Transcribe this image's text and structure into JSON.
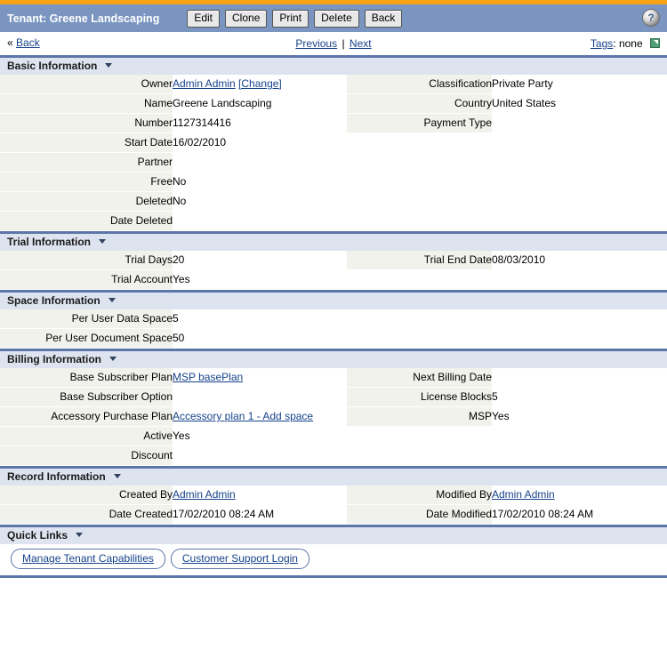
{
  "theme": {
    "accent_orange": "#f9a216",
    "title_bar_blue": "#7a95c0",
    "section_header_blue": "#dde3ef",
    "section_rule_blue": "#5b76a8",
    "label_cell_bg": "#f1f2ec",
    "link_blue": "#15428b"
  },
  "header": {
    "title": "Tenant: Greene Landscaping",
    "buttons": [
      {
        "label": "Edit"
      },
      {
        "label": "Clone"
      },
      {
        "label": "Print"
      },
      {
        "label": "Delete"
      },
      {
        "label": "Back"
      }
    ],
    "help_icon": "?",
    "help_icon_name": "help-icon"
  },
  "nav": {
    "back_chevron": "«",
    "back_label": "Back",
    "previous_label": "Previous",
    "separator": "|",
    "next_label": "Next",
    "tags_label": "Tags",
    "tags_colon": ":",
    "tags_value": "none"
  },
  "sections": [
    {
      "id": "basic-information",
      "title": "Basic Information",
      "rows": [
        {
          "left": {
            "label": "Owner",
            "value": "Admin Admin",
            "link": true,
            "extra": "[Change]",
            "extra_link": true
          },
          "right": {
            "label": "Classification",
            "value": "Private Party"
          }
        },
        {
          "left": {
            "label": "Name",
            "value": "Greene Landscaping"
          },
          "right": {
            "label": "Country",
            "value": "United States"
          }
        },
        {
          "left": {
            "label": "Number",
            "value": "1127314416"
          },
          "right": {
            "label": "Payment Type",
            "value": ""
          }
        },
        {
          "left": {
            "label": "Start Date",
            "value": "16/02/2010"
          },
          "right": null
        },
        {
          "left": {
            "label": "Partner",
            "value": ""
          },
          "right": null
        },
        {
          "left": {
            "label": "Free",
            "value": "No"
          },
          "right": null
        },
        {
          "left": {
            "label": "Deleted",
            "value": "No"
          },
          "right": null
        },
        {
          "left": {
            "label": "Date Deleted",
            "value": ""
          },
          "right": null
        }
      ]
    },
    {
      "id": "trial-information",
      "title": "Trial Information",
      "rows": [
        {
          "left": {
            "label": "Trial Days",
            "value": "20"
          },
          "right": {
            "label": "Trial End Date",
            "value": "08/03/2010"
          }
        },
        {
          "left": {
            "label": "Trial Account",
            "value": "Yes"
          },
          "right": null
        }
      ]
    },
    {
      "id": "space-information",
      "title": "Space Information",
      "rows": [
        {
          "left": {
            "label": "Per User Data Space",
            "value": "5"
          },
          "right": null
        },
        {
          "left": {
            "label": "Per User Document Space",
            "value": "50"
          },
          "right": null
        }
      ]
    },
    {
      "id": "billing-information",
      "title": "Billing Information",
      "rows": [
        {
          "left": {
            "label": "Base Subscriber Plan",
            "value": "MSP basePlan",
            "link": true
          },
          "right": {
            "label": "Next Billing Date",
            "value": ""
          }
        },
        {
          "left": {
            "label": "Base Subscriber Option",
            "value": ""
          },
          "right": {
            "label": "License Blocks",
            "value": "5"
          }
        },
        {
          "left": {
            "label": "Accessory Purchase Plan",
            "value": "Accessory plan 1 - Add space",
            "link": true
          },
          "right": {
            "label": "MSP",
            "value": "Yes"
          }
        },
        {
          "left": {
            "label": "Active",
            "value": "Yes"
          },
          "right": null
        },
        {
          "left": {
            "label": "Discount",
            "value": ""
          },
          "right": null
        }
      ]
    },
    {
      "id": "record-information",
      "title": "Record Information",
      "rows": [
        {
          "left": {
            "label": "Created By",
            "value": "Admin Admin",
            "link": true
          },
          "right": {
            "label": "Modified By",
            "value": "Admin Admin",
            "link": true
          }
        },
        {
          "left": {
            "label": "Date Created",
            "value": "17/02/2010 08:24 AM"
          },
          "right": {
            "label": "Date Modified",
            "value": "17/02/2010 08:24 AM"
          }
        }
      ]
    }
  ],
  "quick_links": {
    "title": "Quick Links",
    "links": [
      {
        "label": "Manage Tenant Capabilities"
      },
      {
        "label": "Customer Support Login"
      }
    ]
  }
}
